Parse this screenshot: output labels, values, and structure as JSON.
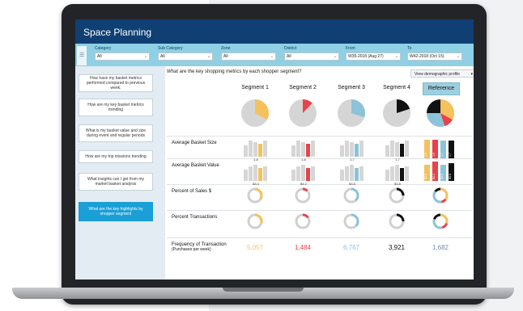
{
  "app": {
    "title": "Space Planning"
  },
  "filters": [
    {
      "label": "Category",
      "value": "All"
    },
    {
      "label": "Sub Category",
      "value": "All"
    },
    {
      "label": "Zone",
      "value": "All"
    },
    {
      "label": "District",
      "value": "All"
    },
    {
      "label": "From",
      "value": "W35-2018 (Aug 27)"
    },
    {
      "label": "To",
      "value": "W42-2018 (Oct 15)"
    }
  ],
  "questions": [
    {
      "text": "How have my basket metrics performed compared to previous week."
    },
    {
      "text": "How are my key basket metrics trending"
    },
    {
      "text": "What is my basket value and size during event and regular periods"
    },
    {
      "text": "How are my trip missions trending"
    },
    {
      "text": "What insights can I get from my market basket analysis"
    },
    {
      "text": "What are the key highlights by shopper segment",
      "active": true
    }
  ],
  "main": {
    "title": "What are the key shopping metrics by each shopper segment?",
    "profile_dropdown": "View demographic profile"
  },
  "segments": [
    {
      "name": "Segment 1",
      "color": "#f4c15d",
      "pie": 0.33,
      "basket_size": [
        0.7,
        1.0,
        0.9,
        0.8,
        1.0
      ],
      "basket_size_label": "1.8",
      "basket_value": [
        0.7,
        0.9,
        1.0,
        0.8,
        0.9
      ],
      "basket_value_label": "$3.4",
      "sales_pct": 0.35,
      "transactions_pct": 0.3,
      "frequency": "5,057"
    },
    {
      "name": "Segment 2",
      "color": "#e8424a",
      "pie": 0.12,
      "basket_size": [
        0.7,
        1.0,
        0.9,
        0.8,
        1.0
      ],
      "basket_size_label": "1.8",
      "basket_value": [
        0.7,
        0.9,
        1.0,
        0.8,
        0.9
      ],
      "basket_value_label": "$4.2",
      "sales_pct": 0.12,
      "transactions_pct": 0.15,
      "frequency": "1,484"
    },
    {
      "name": "Segment 3",
      "color": "#8cc3d8",
      "pie": 0.3,
      "basket_size": [
        0.7,
        1.0,
        0.9,
        0.8,
        1.0
      ],
      "basket_size_label": "1.7",
      "basket_value": [
        0.7,
        0.9,
        1.0,
        0.8,
        0.9
      ],
      "basket_value_label": "$3.5",
      "sales_pct": 0.38,
      "transactions_pct": 0.38,
      "frequency": "6,767"
    },
    {
      "name": "Segment 4",
      "color": "#111111",
      "pie": 0.2,
      "basket_size": [
        0.7,
        1.0,
        0.9,
        0.8,
        1.0
      ],
      "basket_size_label": "1.7",
      "basket_value": [
        0.7,
        0.9,
        1.0,
        0.8,
        0.9
      ],
      "basket_value_label": "$3.8",
      "sales_pct": 0.25,
      "transactions_pct": 0.25,
      "frequency": "3,921"
    }
  ],
  "reference": {
    "name": "Reference",
    "pie": [
      0.33,
      0.12,
      0.3,
      0.25
    ],
    "basket_size": [
      {
        "v": 0.95,
        "label": "1.8"
      },
      {
        "v": 0.95,
        "label": "1.8"
      },
      {
        "v": 0.92,
        "label": "1.7"
      },
      {
        "v": 0.92,
        "label": "1.7"
      }
    ],
    "basket_value": [
      {
        "v": 0.85,
        "label": "$3.4"
      },
      {
        "v": 1.0,
        "label": "$4.2"
      },
      {
        "v": 0.85,
        "label": "$3.5"
      },
      {
        "v": 0.92,
        "label": "$3.8"
      }
    ],
    "sales_pct": [
      0.35,
      0.12,
      0.38,
      0.15
    ],
    "transactions_pct": [
      0.3,
      0.15,
      0.35,
      0.2
    ],
    "frequency": "1,682",
    "frequency_color": "#6a8fb0"
  },
  "rows": [
    {
      "label": "Average Basket Size"
    },
    {
      "label": "Average Basket Value"
    },
    {
      "label": "Percent of Sales $"
    },
    {
      "label": "Percent Transactions"
    },
    {
      "label": "Frequency of Transaction",
      "sub": "(Purchases per week)"
    }
  ]
}
